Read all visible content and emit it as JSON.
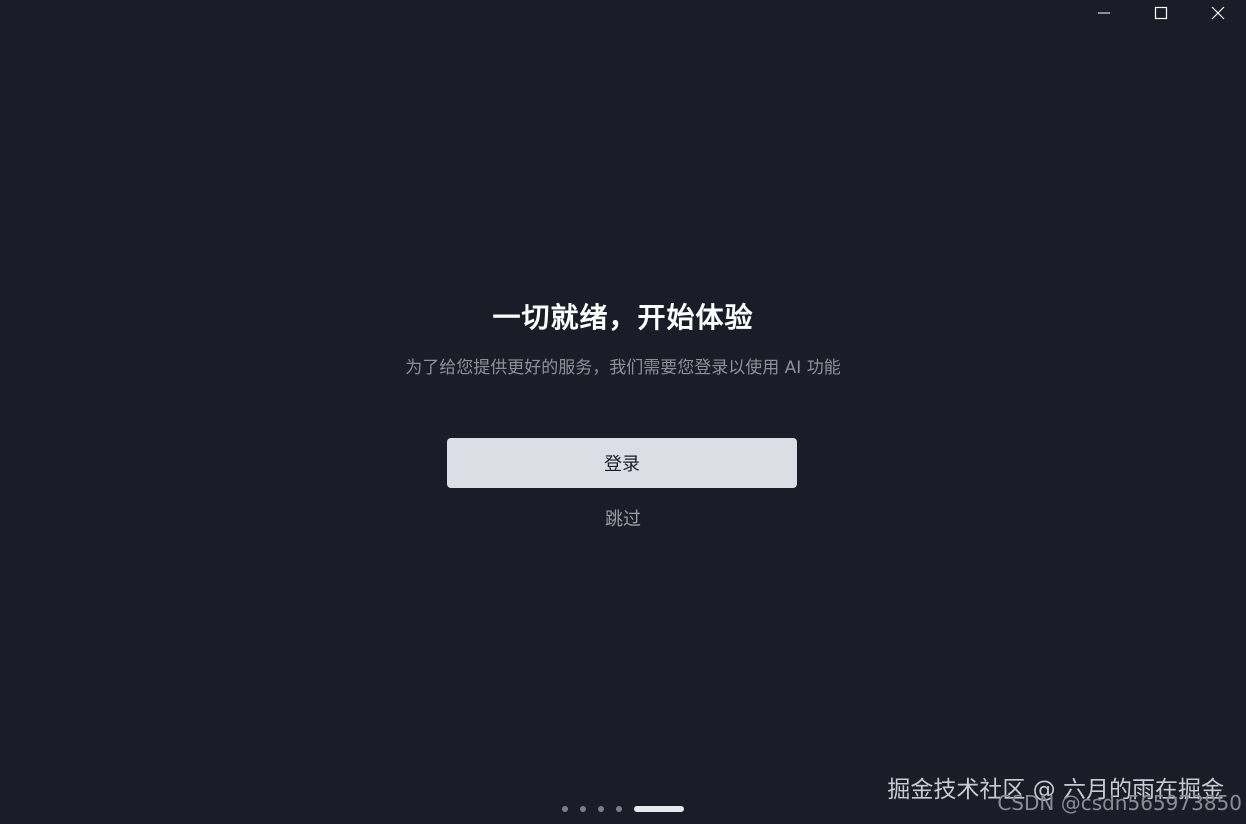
{
  "window": {
    "controls": {
      "minimize_icon": "minimize-icon",
      "maximize_icon": "maximize-icon",
      "close_icon": "close-icon"
    }
  },
  "main": {
    "title": "一切就绪，开始体验",
    "subtitle": "为了给您提供更好的服务，我们需要您登录以使用 AI 功能",
    "login_label": "登录",
    "skip_label": "跳过"
  },
  "pager": {
    "total_pages": 5,
    "active_page": 5
  },
  "watermark": {
    "line1": "掘金技术社区 @ 六月的雨在掘金",
    "line2": "CSDN @csdn565973850"
  },
  "colors": {
    "background": "#1b1c27",
    "button_bg": "#dcdde5",
    "title": "#ffffff",
    "subtitle": "#8d8f99",
    "dot_inactive": "#7b7d88",
    "dot_active": "#e8e9ee"
  }
}
